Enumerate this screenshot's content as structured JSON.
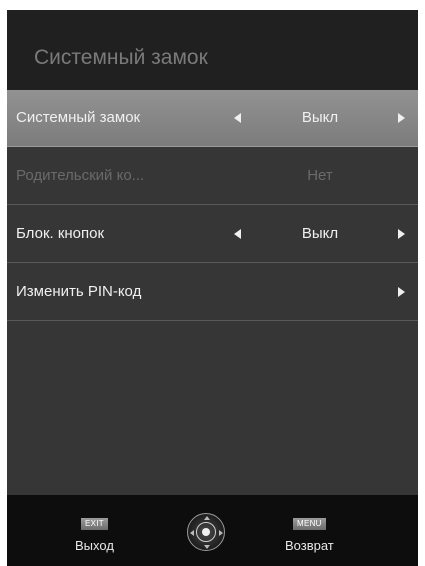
{
  "header": {
    "title": "Системный замок"
  },
  "menu": {
    "items": [
      {
        "label": "Системный замок",
        "value": "Выкл",
        "state": "selected"
      },
      {
        "label": "Родительский ко...",
        "value": "Нет",
        "state": "disabled"
      },
      {
        "label": "Блок. кнопок",
        "value": "Выкл",
        "state": "normal"
      },
      {
        "label": "Изменить PIN-код",
        "value": "",
        "state": "normal"
      }
    ]
  },
  "footer": {
    "exit_key": "EXIT",
    "exit_label": "Выход",
    "menu_key": "MENU",
    "menu_label": "Возврат"
  },
  "icons": {
    "nav": "dpad-navigation-icon",
    "left": "arrow-left-icon",
    "right": "arrow-right-icon"
  },
  "colors": {
    "panel": "#363636",
    "header": "#202020",
    "footer": "#0d0d0d",
    "selected_row": "#8a8a8a",
    "text": "#f0f0f0",
    "disabled_text": "#6a6a6a"
  }
}
